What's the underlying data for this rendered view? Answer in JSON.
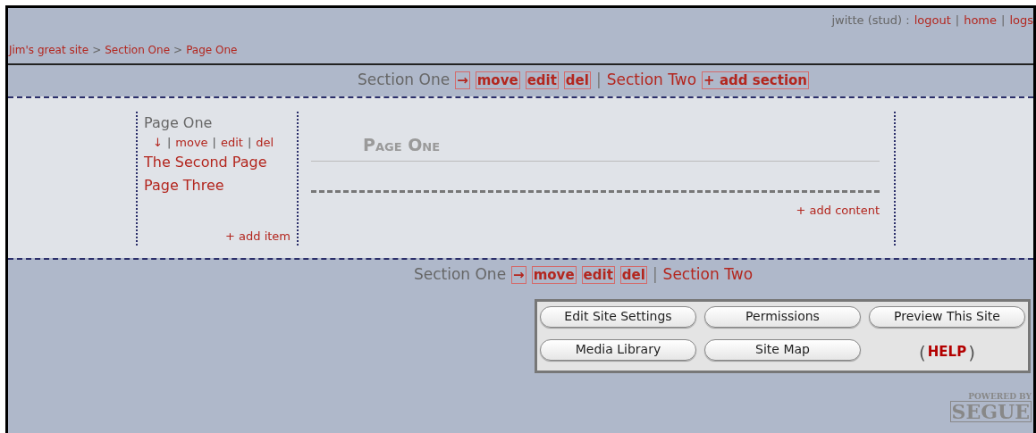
{
  "header": {
    "user": "jwitte (stud) :",
    "links": [
      "logout",
      "home",
      "logs"
    ],
    "separator": "|"
  },
  "breadcrumb": [
    "Jim's great site",
    "Section One",
    "Page One"
  ],
  "breadcrumb_separator": ">",
  "section_nav_top": {
    "sections": [
      {
        "label": "Section One",
        "selected": true,
        "controls": [
          "→",
          "move",
          "edit",
          "del"
        ]
      },
      {
        "label": "Section Two",
        "selected": false
      }
    ],
    "separator": "|",
    "add": "+ add section"
  },
  "page_nav": {
    "items": [
      {
        "label": "Page One",
        "selected": true,
        "controls": [
          "↓",
          "move",
          "edit",
          "del"
        ]
      },
      {
        "label": "The Second Page",
        "selected": false
      },
      {
        "label": "Page Three",
        "selected": false
      }
    ],
    "separator": "|",
    "add": "+ add item"
  },
  "content": {
    "title": "Page One",
    "add": "+ add content"
  },
  "section_nav_bottom": {
    "sections": [
      {
        "label": "Section One",
        "selected": true,
        "controls": [
          "→",
          "move",
          "edit",
          "del"
        ]
      },
      {
        "label": "Section Two",
        "selected": false
      }
    ],
    "separator": "|"
  },
  "tools": {
    "buttons": [
      "Edit Site Settings",
      "Permissions",
      "Preview This Site",
      "Media Library",
      "Site Map"
    ],
    "help_open": "(",
    "help": "HELP",
    "help_close": ")"
  },
  "logo": {
    "top": "POWERED BY",
    "bottom": "SEGUE"
  }
}
